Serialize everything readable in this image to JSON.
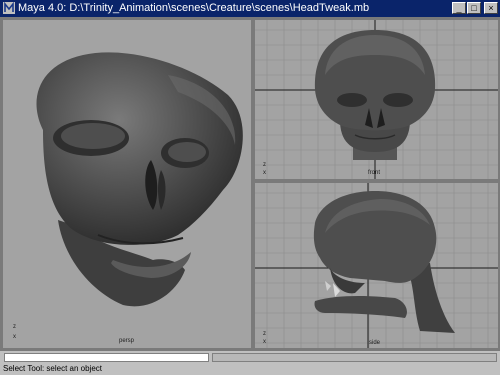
{
  "window": {
    "title": "Maya 4.0: D:\\Trinity_Animation\\scenes\\Creature\\scenes\\HeadTweak.mb",
    "minimize_glyph": "_",
    "maximize_glyph": "□",
    "close_glyph": "×"
  },
  "viewports": {
    "persp": {
      "camera_label": "persp",
      "axis_x": "x",
      "axis_z": "z"
    },
    "front": {
      "camera_label": "front",
      "axis_x": "x",
      "axis_z": "z"
    },
    "side": {
      "camera_label": "side",
      "axis_x": "x",
      "axis_z": "z"
    }
  },
  "status": {
    "help_text": "Select Tool: select an object"
  },
  "colors": {
    "title_bar": "#0a246a",
    "viewport_bg": "#a3a3a3",
    "mesh": "#4a4a4a"
  }
}
